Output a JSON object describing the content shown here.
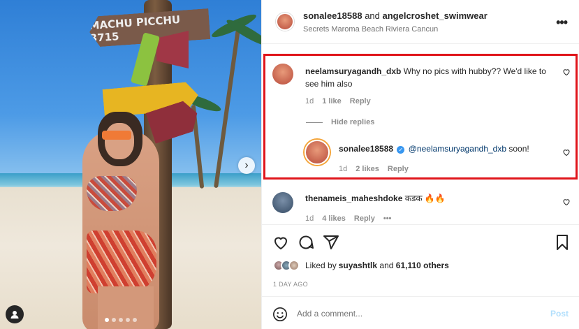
{
  "photo": {
    "sign_text_1": "MACHU PICCHU 3715",
    "carousel_next": "›"
  },
  "header": {
    "user1": "sonalee18588",
    "conj": " and ",
    "user2": "angelcroshet_swimwear",
    "location": "Secrets Maroma Beach Riviera Cancun",
    "more": "•••"
  },
  "comments": [
    {
      "username": "neelamsuryagandh_dxb",
      "text": "Why no pics with hubby?? We'd like to see him also",
      "time": "1d",
      "likes": "1 like",
      "reply": "Reply"
    },
    {
      "hide_replies": "Hide replies",
      "username": "sonalee18588",
      "verified": "✓",
      "mention": "@neelamsuryagandh_dxb",
      "text": " soon!",
      "time": "1d",
      "likes": "2 likes",
      "reply": "Reply"
    },
    {
      "username": "thenameis_maheshdoke",
      "text": "कडक 🔥🔥",
      "time": "1d",
      "likes": "4 likes",
      "reply": "Reply",
      "more": "•••"
    }
  ],
  "actions": {
    "liked_prefix": "Liked by ",
    "liked_user": "suyashtlk",
    "liked_mid": " and ",
    "liked_count": "61,110 others",
    "time_ago": "1 DAY AGO"
  },
  "add_comment": {
    "placeholder": "Add a comment...",
    "post": "Post"
  },
  "colors": {
    "highlight_border": "#e0151b",
    "link": "#00376b",
    "post_disabled": "#b2dffc"
  },
  "icons": [
    "heart-icon",
    "comment-icon",
    "share-icon",
    "bookmark-icon",
    "emoji-icon",
    "more-icon",
    "chevron-right-icon",
    "user-tag-icon",
    "verified-icon"
  ]
}
